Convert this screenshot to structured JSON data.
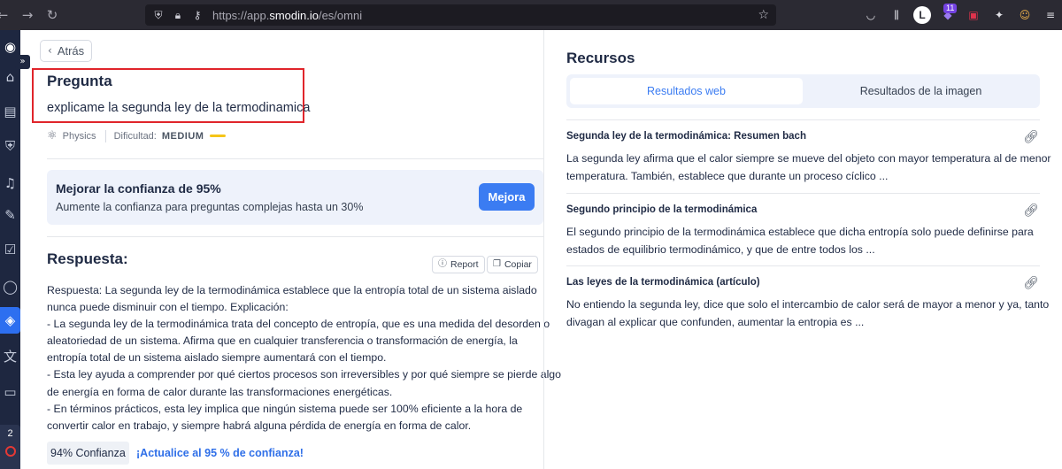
{
  "browser": {
    "url_prefix": "https://app.",
    "url_domain": "smodin.io",
    "url_path": "/es/omni",
    "extension_badge": "11",
    "profile_letter": "L"
  },
  "sidebar": {
    "items": [
      "logo-icon",
      "home-icon",
      "clipboard-icon",
      "shield-icon",
      "bell-icon",
      "pen-icon",
      "checklist-icon",
      "chat-icon",
      "layers-icon",
      "translate-icon",
      "folder-icon"
    ],
    "active_item": "layers-icon",
    "counter": "2"
  },
  "main": {
    "back_label": "Atrás",
    "question_heading": "Pregunta",
    "question_text": "explicame la segunda ley de la termodinamica",
    "subject": "Physics",
    "difficulty_label": "Dificultad:",
    "difficulty_value": "MEDIUM",
    "promo": {
      "title": "Mejorar la confianza de 95%",
      "subtitle": "Aumente la confianza para preguntas complejas hasta un 30%",
      "button": "Mejora"
    },
    "answer_heading": "Respuesta:",
    "report_label": "Report",
    "copy_label": "Copiar",
    "answer_lines": [
      "Respuesta: La segunda ley de la termodinámica establece que la entropía total de un sistema aislado",
      "nunca puede disminuir con el tiempo. Explicación:",
      "- La segunda ley de la termodinámica trata del concepto de entropía, que es una medida del desorden o",
      "aleatoriedad de un sistema. Afirma que en cualquier transferencia o transformación de energía, la",
      "entropía total de un sistema aislado siempre aumentará con el tiempo.",
      "- Esta ley ayuda a comprender por qué ciertos procesos son irreversibles y por qué siempre se pierde algo",
      "de energía en forma de calor durante las transformaciones energéticas.",
      "- En términos prácticos, esta ley implica que ningún sistema puede ser 100% eficiente a la hora de",
      "convertir calor en trabajo, y siempre habrá alguna pérdida de energía en forma de calor."
    ],
    "confidence": "94% Confianza",
    "upgrade_link": "¡Actualice al 95 % de confianza!"
  },
  "resources": {
    "heading": "Recursos",
    "tabs": [
      "Resultados web",
      "Resultados de la imagen"
    ],
    "active_tab": "Resultados web",
    "items": [
      {
        "title": "Segunda ley de la termodinámica: Resumen bach",
        "lines": [
          "La segunda ley afirma que el calor siempre se mueve del objeto con mayor temperatura al de menor",
          "temperatura. También, establece que durante un proceso cíclico ..."
        ]
      },
      {
        "title": "Segundo principio de la termodinámica",
        "lines": [
          "El segundo principio de la termodinámica establece que dicha entropía solo puede definirse para",
          "estados de equilibrio termodinámico, y que de entre todos los ..."
        ]
      },
      {
        "title": "Las leyes de la termodinámica (artículo)",
        "lines": [
          "No entiendo la segunda ley, dice que solo el intercambio de calor será de mayor a menor y ya, tanto",
          "divagan al explicar que confunden, aumentar la entropia es ..."
        ]
      }
    ]
  }
}
